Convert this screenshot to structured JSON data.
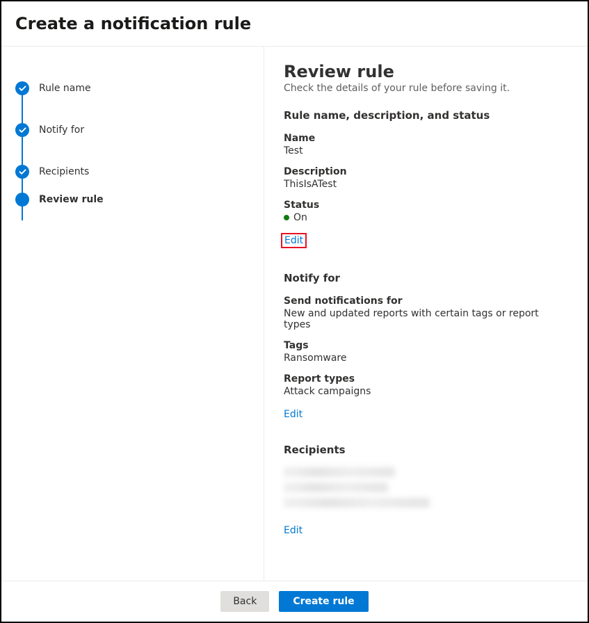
{
  "header": {
    "title": "Create a notification rule"
  },
  "steps": [
    {
      "label": "Rule name",
      "state": "done"
    },
    {
      "label": "Notify for",
      "state": "done"
    },
    {
      "label": "Recipients",
      "state": "done"
    },
    {
      "label": "Review rule",
      "state": "current"
    }
  ],
  "review": {
    "title": "Review rule",
    "subtitle": "Check the details of your rule before saving it.",
    "sections": {
      "ruleInfo": {
        "heading": "Rule name, description, and status",
        "name": {
          "label": "Name",
          "value": "Test"
        },
        "description": {
          "label": "Description",
          "value": "ThisIsATest"
        },
        "status": {
          "label": "Status",
          "value": "On",
          "color": "#107c10"
        },
        "editLabel": "Edit"
      },
      "notifyFor": {
        "heading": "Notify for",
        "sendFor": {
          "label": "Send notifications for",
          "value": "New and updated reports with certain tags or report types"
        },
        "tags": {
          "label": "Tags",
          "value": "Ransomware"
        },
        "reportTypes": {
          "label": "Report types",
          "value": "Attack campaigns"
        },
        "editLabel": "Edit"
      },
      "recipients": {
        "heading": "Recipients",
        "editLabel": "Edit"
      }
    }
  },
  "footer": {
    "backLabel": "Back",
    "createLabel": "Create rule"
  }
}
